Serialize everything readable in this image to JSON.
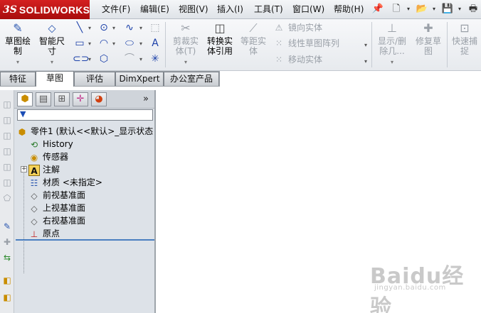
{
  "app": {
    "logo_prefix": "3S",
    "logo_name": "SOLIDWORKS"
  },
  "menu": {
    "items": [
      "文件(F)",
      "编辑(E)",
      "视图(V)",
      "插入(I)",
      "工具(T)",
      "窗口(W)",
      "帮助(H)"
    ],
    "pin_icon": "pushpin-icon",
    "quick_icons": [
      "new-document-icon",
      "open-folder-icon",
      "save-icon",
      "print-icon"
    ]
  },
  "toolbar": {
    "sketch": "草图绘制",
    "smart_dimension": "智能尺寸",
    "trim": "剪裁实体(T)",
    "convert": "转换实体引用",
    "offset": "等距实体",
    "mirror": "镜向实体",
    "linear_pattern": "线性草图阵列",
    "move": "移动实体",
    "show_delete": "显示/删除几...",
    "repair": "修复草图",
    "quick_snap": "快速捕捉"
  },
  "tabs": [
    "特征",
    "草图",
    "评估",
    "DimXpert",
    "办公室产品"
  ],
  "active_tab": 1,
  "feature_manager": {
    "root": "零件1 (默认<<默认>_显示状态",
    "nodes": [
      "History",
      "传感器",
      "注解",
      "材质 <未指定>",
      "前视基准面",
      "上视基准面",
      "右视基准面",
      "原点"
    ],
    "more": "»"
  },
  "watermark": {
    "brand": "Baidu经验",
    "url": "jingyan.baidu.com"
  }
}
